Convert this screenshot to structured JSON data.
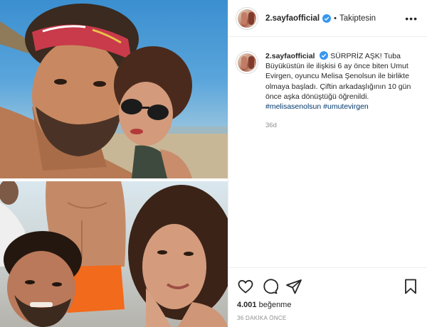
{
  "post": {
    "username": "2.sayfaofficial",
    "verified": true,
    "separator": "•",
    "follow_state": "Takiptesin",
    "more_icon": "more-horizontal-icon"
  },
  "caption": {
    "username": "2.sayfaofficial",
    "text": "SÜRPRİZ AŞK! Tuba Büyüküstün ile ilişkisi 6 ay önce biten Umut Evirgen, oyuncu Melisa Şenolsun ile birlikte olmaya başladı. Çiftin arkadaşlığının 10 gün önce aşka dönüştüğü öğrenildi.",
    "hashtags": [
      "#melisasenolsun",
      "#umutevirgen"
    ],
    "age": "36d"
  },
  "actions": {
    "like_icon": "heart-icon",
    "comment_icon": "comment-icon",
    "share_icon": "send-icon",
    "save_icon": "bookmark-icon"
  },
  "likes": {
    "count": "4.001",
    "label": "beğenme"
  },
  "timestamp": "36 DAKİKA ÖNCE",
  "colors": {
    "verified_badge": "#3897f0",
    "hashtag": "#00376b",
    "muted": "#8e8e8e",
    "border": "#efefef"
  }
}
